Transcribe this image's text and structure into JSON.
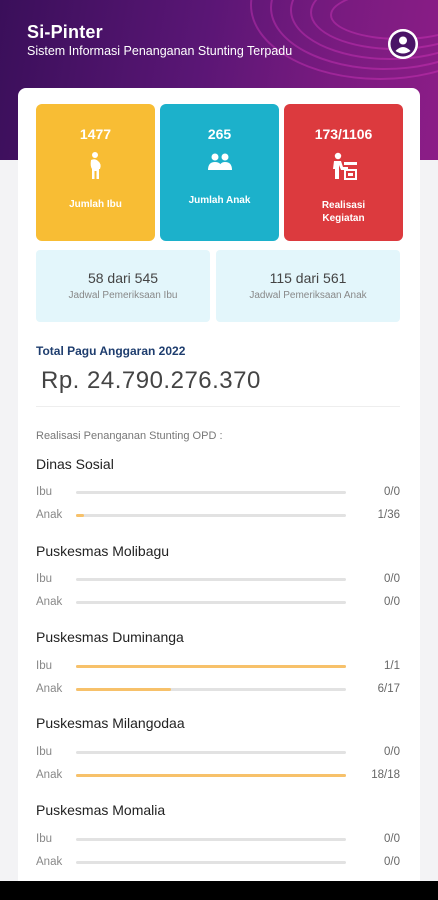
{
  "header": {
    "title": "Si-Pinter",
    "subtitle": "Sistem Informasi Penanganan Stunting Terpadu",
    "colors": {
      "start": "#3a0f5a",
      "end": "#8c1d87"
    }
  },
  "tiles": [
    {
      "value": "1477",
      "label": "Jumlah Ibu",
      "icon": "pregnant-woman-icon",
      "color": "#f8bd34"
    },
    {
      "value": "265",
      "label": "Jumlah Anak",
      "icon": "children-icon",
      "color": "#1cb1cb"
    },
    {
      "value": "173/1106",
      "label": "Realisasi Kegiatan",
      "icon": "activity-icon",
      "color": "#dc3a3e"
    }
  ],
  "schedules": [
    {
      "value": "58 dari 545",
      "label": "Jadwal Pemeriksaan Ibu"
    },
    {
      "value": "115 dari 561",
      "label": "Jadwal Pemeriksaan Anak"
    }
  ],
  "pagu": {
    "label": "Total Pagu Anggaran 2022",
    "value": "Rp. 24.790.276.370"
  },
  "realisasi": {
    "title": "Realisasi Penanganan Stunting OPD :",
    "items": [
      {
        "name": "Dinas Sosial",
        "ibu": {
          "label": "Ibu",
          "value": "0/0",
          "progress": 0
        },
        "anak": {
          "label": "Anak",
          "value": "1/36",
          "progress": 0.028
        }
      },
      {
        "name": "Puskesmas Molibagu",
        "ibu": {
          "label": "Ibu",
          "value": "0/0",
          "progress": 0
        },
        "anak": {
          "label": "Anak",
          "value": "0/0",
          "progress": 0
        }
      },
      {
        "name": "Puskesmas Duminanga",
        "ibu": {
          "label": "Ibu",
          "value": "1/1",
          "progress": 1
        },
        "anak": {
          "label": "Anak",
          "value": "6/17",
          "progress": 0.353
        }
      },
      {
        "name": "Puskesmas Milangodaa",
        "ibu": {
          "label": "Ibu",
          "value": "0/0",
          "progress": 0
        },
        "anak": {
          "label": "Anak",
          "value": "18/18",
          "progress": 1
        }
      },
      {
        "name": "Puskesmas Momalia",
        "ibu": {
          "label": "Ibu",
          "value": "0/0",
          "progress": 0
        },
        "anak": {
          "label": "Anak",
          "value": "0/0",
          "progress": 0
        }
      }
    ]
  }
}
